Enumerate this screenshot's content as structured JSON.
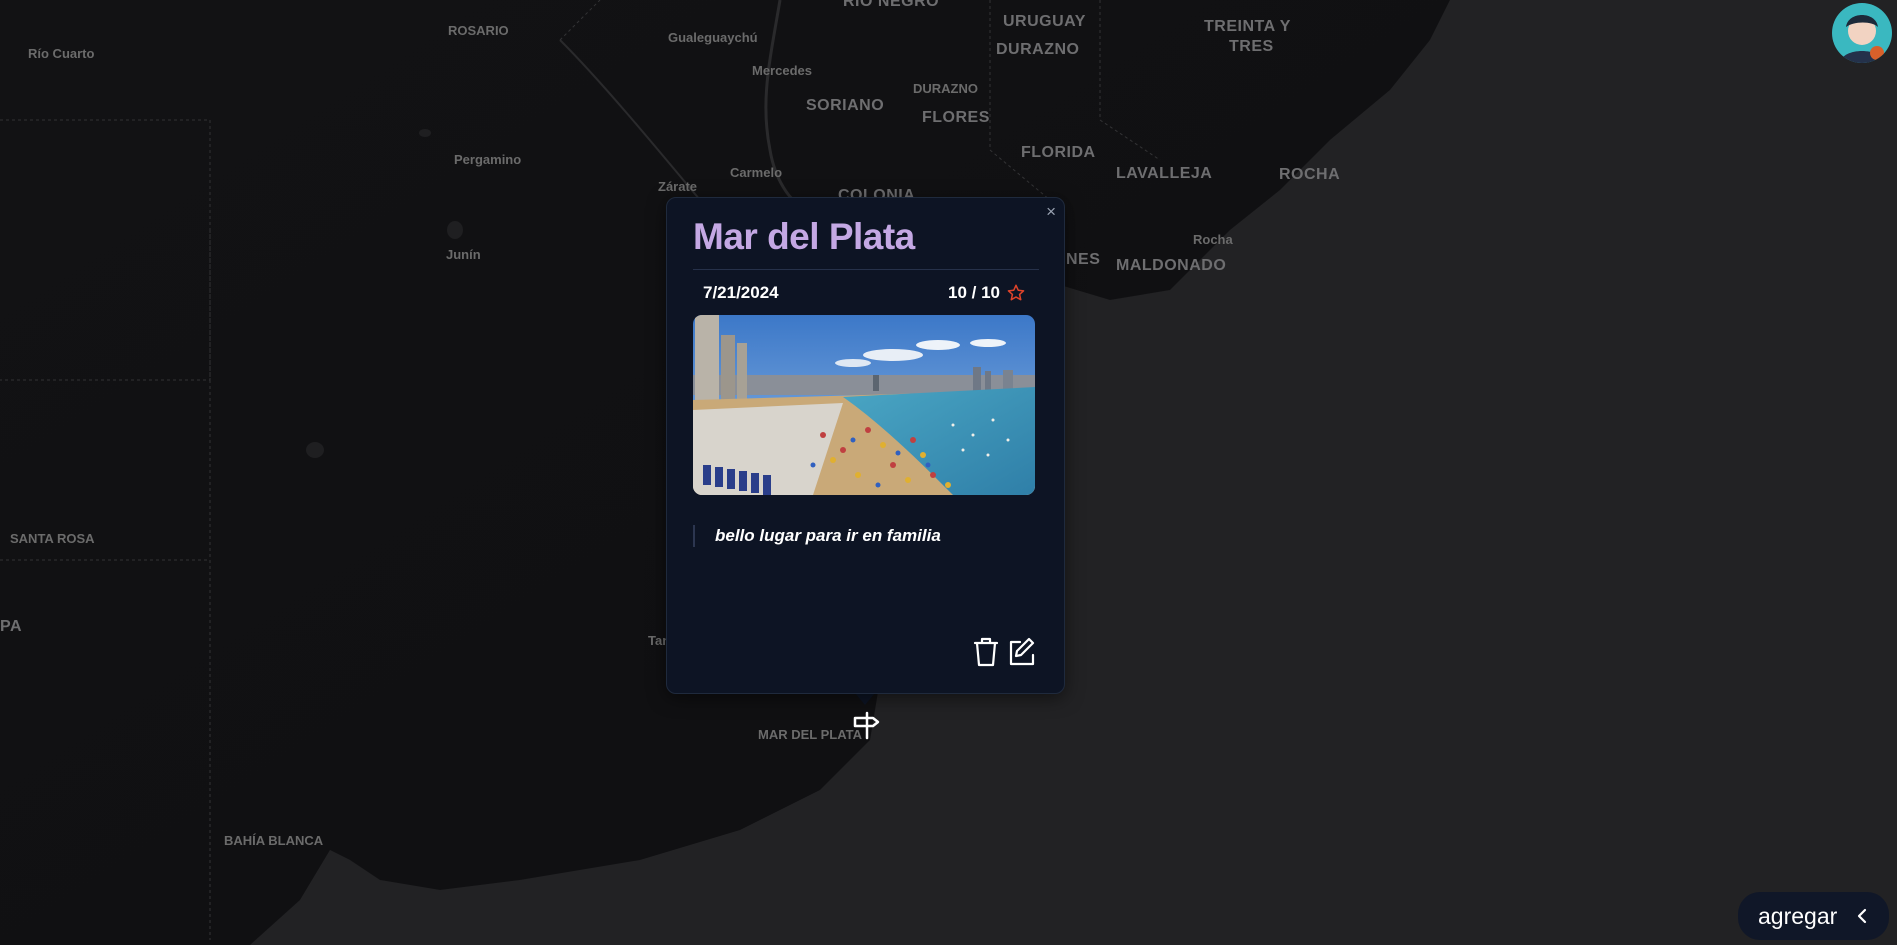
{
  "map": {
    "labels_small": [
      "Río Cuarto",
      "ROSARIO",
      "Gualeguaychú",
      "Mercedes",
      "Pergamino",
      "Carmelo",
      "Zárate",
      "Junín",
      "DURAZNO",
      "Rocha",
      "SANTA ROSA",
      "BAHÍA BLANCA",
      "Tan"
    ],
    "labels_big": [
      "RIO NEGRO",
      "URUGUAY",
      "DURAZNO",
      "TREINTA Y",
      "TRES",
      "SORIANO",
      "FLORES",
      "FLORIDA",
      "LAVALLEJA",
      "ROCHA",
      "COLONIA",
      "NES",
      "MALDONADO",
      "PA"
    ],
    "marker_label": "MAR DEL PLATA"
  },
  "popup": {
    "title": "Mar del Plata",
    "close_label": "×",
    "date": "7/21/2024",
    "rating": "10 / 10",
    "review": "bello lugar para ir en familia",
    "image_alt": "Mar del Plata beach photo"
  },
  "add_button": {
    "label": "agregar"
  },
  "colors": {
    "popup_bg": "#0d1424",
    "title": "#c4a8e4",
    "star": "#e0442a",
    "map_bg": "#1c1c1e"
  },
  "icons": {
    "close": "close-icon",
    "star": "star-icon",
    "trash": "trash-icon",
    "edit": "edit-icon",
    "marker": "signpost-marker-icon",
    "chevron": "chevron-left-icon"
  }
}
